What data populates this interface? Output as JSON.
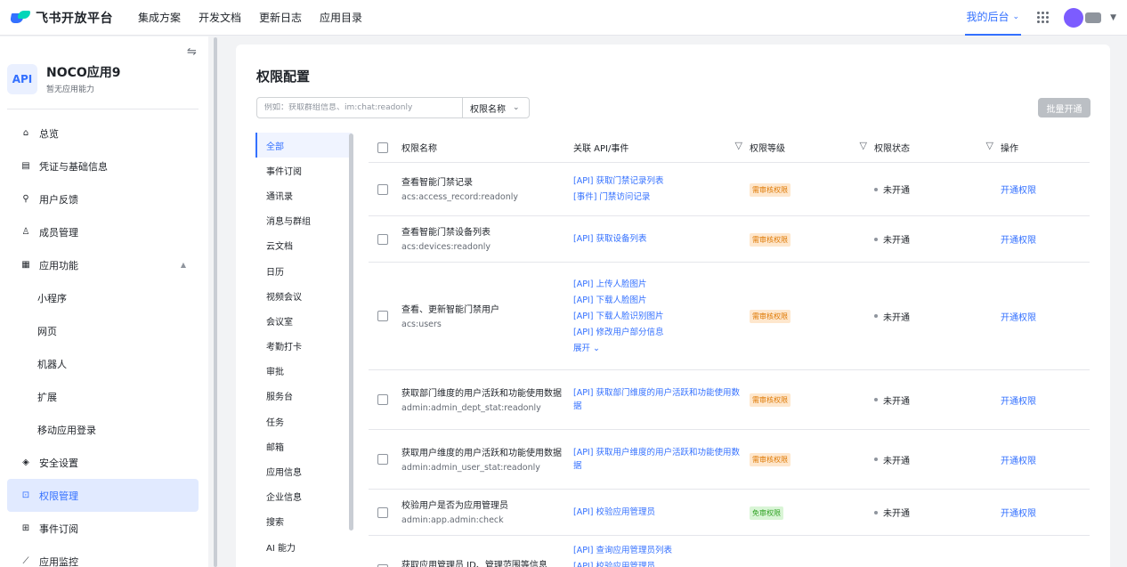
{
  "topbar": {
    "brand": "飞书开放平台",
    "links": [
      "集成方案",
      "开发文档",
      "更新日志",
      "应用目录"
    ],
    "backend": "我的后台"
  },
  "sidebar": {
    "app_icon_text": "API",
    "app_name": "NOCO应用9",
    "app_sub": "暂无应用能力",
    "items": [
      {
        "icon": "⌂",
        "label": "总览"
      },
      {
        "icon": "▤",
        "label": "凭证与基础信息"
      },
      {
        "icon": "⚲",
        "label": "用户反馈"
      },
      {
        "icon": "♙",
        "label": "成员管理"
      },
      {
        "icon": "▦",
        "label": "应用功能"
      },
      {
        "label": "小程序"
      },
      {
        "label": "网页"
      },
      {
        "label": "机器人"
      },
      {
        "label": "扩展"
      },
      {
        "label": "移动应用登录"
      },
      {
        "icon": "◈",
        "label": "安全设置"
      },
      {
        "icon": "⊡",
        "label": "权限管理"
      },
      {
        "icon": "⊞",
        "label": "事件订阅"
      },
      {
        "icon": "⟋",
        "label": "应用监控"
      }
    ]
  },
  "main": {
    "title": "权限配置",
    "search_placeholder": "例如：获取群组信息、im:chat:readonly",
    "search_type": "权限名称",
    "batch_button": "批量开通",
    "categories": [
      "全部",
      "事件订阅",
      "通讯录",
      "消息与群组",
      "云文档",
      "日历",
      "视频会议",
      "会议室",
      "考勤打卡",
      "审批",
      "服务台",
      "任务",
      "邮箱",
      "应用信息",
      "企业信息",
      "搜索",
      "AI 能力"
    ],
    "columns": {
      "name": "权限名称",
      "api": "关联 API/事件",
      "level": "权限等级",
      "status": "权限状态",
      "op": "操作"
    },
    "rows": [
      {
        "name": "查看智能门禁记录",
        "code": "acs:access_record:readonly",
        "apis": [
          "[API] 获取门禁记录列表",
          "[事件] 门禁访问记录"
        ],
        "level": "需审核权限",
        "status": "未开通",
        "op": "开通权限"
      },
      {
        "name": "查看智能门禁设备列表",
        "code": "acs:devices:readonly",
        "apis": [
          "[API] 获取设备列表"
        ],
        "level": "需审核权限",
        "status": "未开通",
        "op": "开通权限"
      },
      {
        "name": "查看、更新智能门禁用户",
        "code": "acs:users",
        "apis": [
          "[API] 上传人脸图片",
          "[API] 下载人脸图片",
          "[API] 下载人脸识别图片",
          "[API] 修改用户部分信息",
          "展开"
        ],
        "level": "需审核权限",
        "status": "未开通",
        "op": "开通权限"
      },
      {
        "name": "获取部门维度的用户活跃和功能使用数据",
        "code": "admin:admin_dept_stat:readonly",
        "apis": [
          "[API] 获取部门维度的用户活跃和功能使用数据"
        ],
        "level": "需审核权限",
        "status": "未开通",
        "op": "开通权限"
      },
      {
        "name": "获取用户维度的用户活跃和功能使用数据",
        "code": "admin:admin_user_stat:readonly",
        "apis": [
          "[API] 获取用户维度的用户活跃和功能使用数据"
        ],
        "level": "需审核权限",
        "status": "未开通",
        "op": "开通权限"
      },
      {
        "name": "校验用户是否为应用管理员",
        "code": "admin:app.admin:check",
        "apis": [
          "[API] 校验应用管理员"
        ],
        "level": "免审权限",
        "status": "未开通",
        "op": "开通权限"
      },
      {
        "name": "获取应用管理员 ID、管理范围等信息",
        "code": "",
        "apis": [
          "[API] 查询应用管理员列表",
          "[API] 校验应用管理员"
        ],
        "level": "",
        "status": "",
        "op": ""
      }
    ]
  },
  "colors": {
    "accent": "#3370ff",
    "review_badge": "#de7802",
    "free_badge": "#2ea121"
  }
}
